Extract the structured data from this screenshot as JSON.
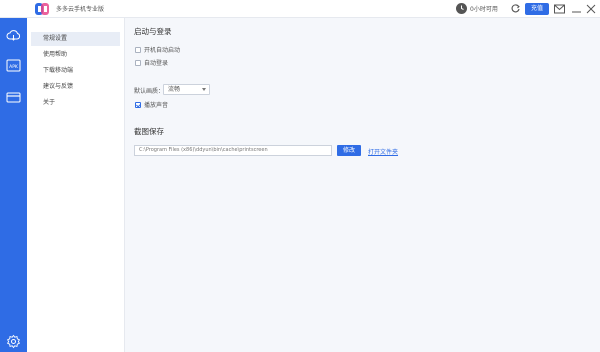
{
  "app": {
    "title": "多多云手机专业版"
  },
  "titlebar": {
    "time_text": "0小时可用",
    "recharge_label": "充值"
  },
  "nav": {
    "items": [
      {
        "label": "常规设置"
      },
      {
        "label": "使用帮助"
      },
      {
        "label": "下载移动端"
      },
      {
        "label": "建议与反馈"
      },
      {
        "label": "关于"
      }
    ]
  },
  "settings": {
    "startup": {
      "title": "启动与登录",
      "options": [
        {
          "label": "开机自动启动",
          "checked": false
        },
        {
          "label": "自动登录",
          "checked": false
        }
      ]
    },
    "quality": {
      "label": "默认画质：",
      "value": "流畅"
    },
    "sound": {
      "label": "播放声音",
      "checked": true
    },
    "screenshot": {
      "title": "截图保存",
      "path": "C:\\Program Files (x86)\\ddyun\\bin\\cache\\printscreen",
      "modify_label": "修改",
      "open_label": "打开文件夹"
    }
  },
  "colors": {
    "accent": "#2f6ce5",
    "rail": "#2f6ce5",
    "background": "#f5f7fb"
  }
}
